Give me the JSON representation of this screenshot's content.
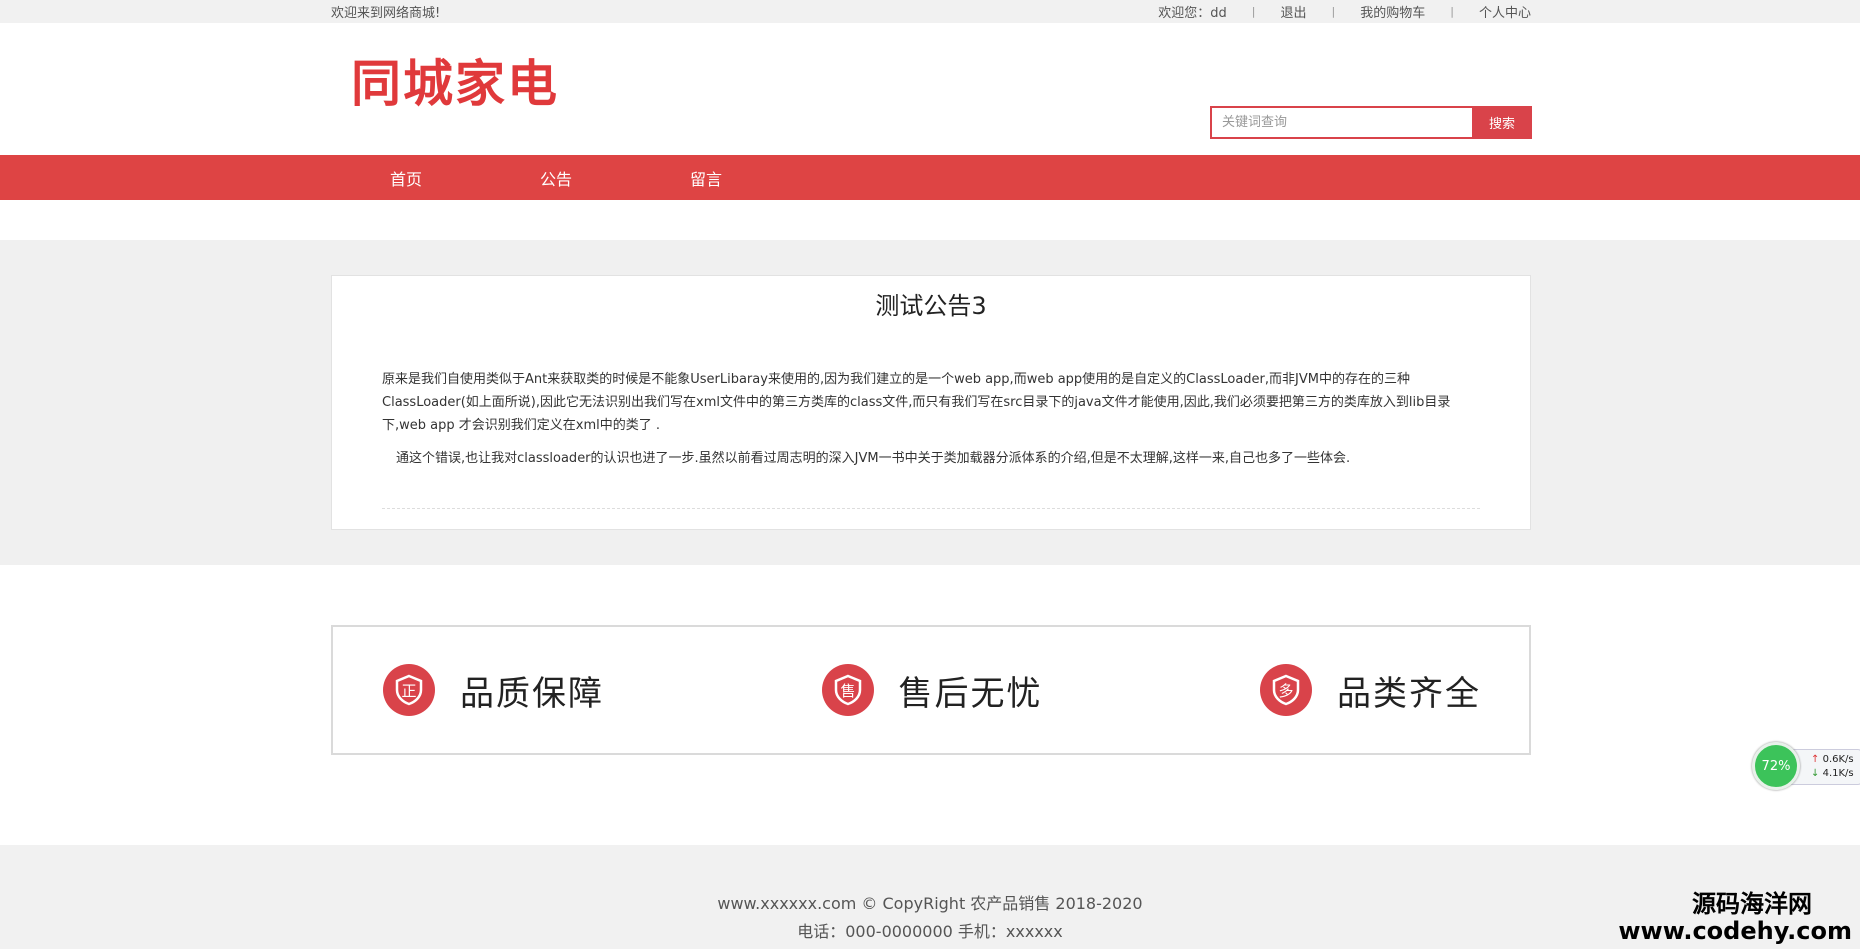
{
  "topbar": {
    "welcome": "欢迎来到网络商城!",
    "user_greeting": "欢迎您：dd",
    "logout": "退出",
    "cart": "我的购物车",
    "profile": "个人中心"
  },
  "header": {
    "logo": "同城家电",
    "search": {
      "placeholder": "关键词查询",
      "button": "搜索"
    }
  },
  "nav": {
    "items": [
      "首页",
      "公告",
      "留言"
    ]
  },
  "article": {
    "title": "测试公告3",
    "paragraphs": [
      "原来是我们自使用类似于Ant来获取类的时候是不能象UserLibaray来使用的,因为我们建立的是一个web app,而web app使用的是自定义的ClassLoader,而非JVM中的存在的三种ClassLoader(如上面所说),因此它无法识别出我们写在xml文件中的第三方类库的class文件,而只有我们写在src目录下的java文件才能使用,因此,我们必须要把第三方的类库放入到lib目录下,web app 才会识别我们定义在xml中的类了 .",
      "通这个错误,也让我对classloader的认识也进了一步.虽然以前看过周志明的深入JVM一书中关于类加载器分派体系的介绍,但是不太理解,这样一来,自己也多了一些体会."
    ]
  },
  "features": [
    {
      "icon": "正",
      "label": "品质保障"
    },
    {
      "icon": "售",
      "label": "售后无忧"
    },
    {
      "icon": "多",
      "label": "品类齐全"
    }
  ],
  "footer": {
    "copyright": "www.xxxxxx.com © CopyRight 农产品销售 2018-2020",
    "contact": "电话：000-0000000 手机：xxxxxx"
  },
  "speed_widget": {
    "percent": "72%",
    "up": "0.6K/s",
    "down": "4.1K/s"
  },
  "watermark": {
    "line1": "源码海洋网",
    "line2": "www.codehy.com"
  },
  "colors": {
    "brand_red": "#de4444",
    "band_gray": "#f0f0f0"
  }
}
